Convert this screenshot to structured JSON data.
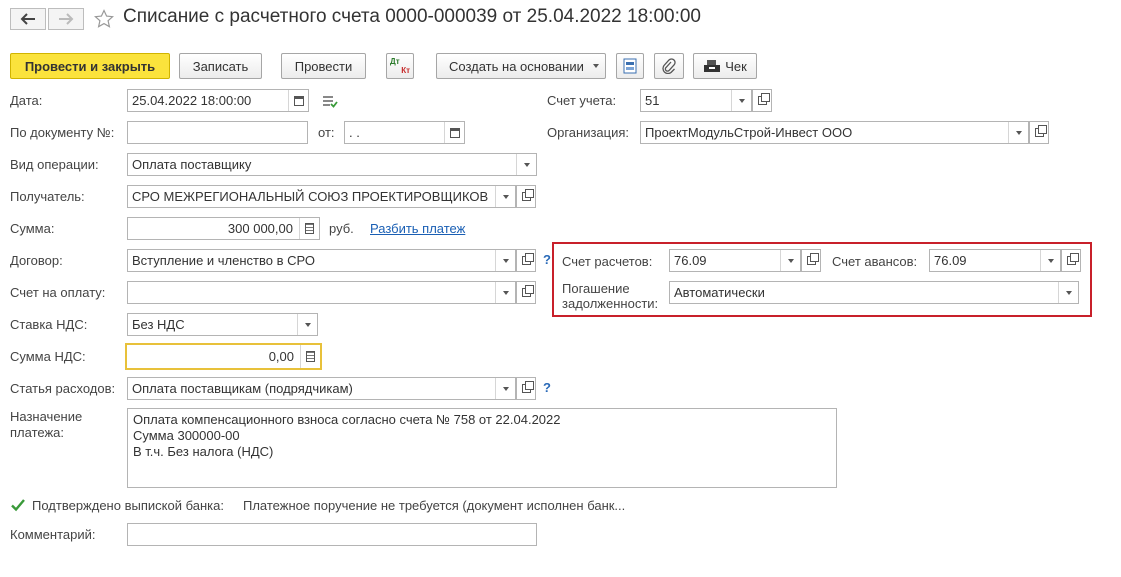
{
  "window": {
    "title": "Списание с расчетного счета 0000-000039 от 25.04.2022 18:00:00"
  },
  "toolbar": {
    "post_close": "Провести и закрыть",
    "save": "Записать",
    "post": "Провести",
    "dtkt_top": "Дт",
    "dtkt_bottom": "Кт",
    "create_based": "Создать на основании",
    "receipt": "Чек"
  },
  "form": {
    "date_label": "Дата:",
    "date_value": "25.04.2022 18:00:00",
    "doc_no_label": "По документу №:",
    "doc_no_value": "",
    "from_label": "от:",
    "from_value": " .  .",
    "operation_label": "Вид операции:",
    "operation_value": "Оплата поставщику",
    "recipient_label": "Получатель:",
    "recipient_value": "СРО МЕЖРЕГИОНАЛЬНЫЙ СОЮЗ ПРОЕКТИРОВЩИКОВ",
    "amount_label": "Сумма:",
    "amount_value": "300 000,00",
    "currency": "руб.",
    "split_link": "Разбить платеж",
    "contract_label": "Договор:",
    "contract_value": "Вступление и членство в СРО",
    "invoice_label": "Счет на оплату:",
    "invoice_value": "",
    "vat_rate_label": "Ставка НДС:",
    "vat_rate_value": "Без НДС",
    "vat_sum_label": "Сумма НДС:",
    "vat_sum_value": "0,00",
    "expense_label": "Статья расходов:",
    "expense_value": "Оплата поставщикам (подрядчикам)",
    "purpose_label_1": "Назначение",
    "purpose_label_2": "платежа:",
    "purpose_lines": [
      "Оплата компенсационного взноса согласно счета № 758 от 22.04.2022",
      "Сумма 300000-00",
      "В т.ч. Без налога (НДС)"
    ],
    "confirmed_label": "Подтверждено выпиской банка:",
    "confirmed_checked": true,
    "payment_order_text": "Платежное поручение не требуется (документ исполнен банк...",
    "comment_label": "Комментарий:",
    "comment_value": "",
    "account_label": "Счет учета:",
    "account_value": "51",
    "org_label": "Организация:",
    "org_value": "ПроектМодульСтрой-Инвест ООО",
    "settle_account_label": "Счет расчетов:",
    "settle_account_value": "76.09",
    "advance_account_label": "Счет авансов:",
    "advance_account_value": "76.09",
    "debt_label_1": "Погашение",
    "debt_label_2": "задолженности:",
    "debt_value": "Автоматически",
    "help_mark": "?"
  },
  "colors": {
    "primary_button": "#fbe33c",
    "highlight_border": "#c8202a",
    "focus_border": "#e8c13a",
    "link": "#1a5fb4"
  }
}
